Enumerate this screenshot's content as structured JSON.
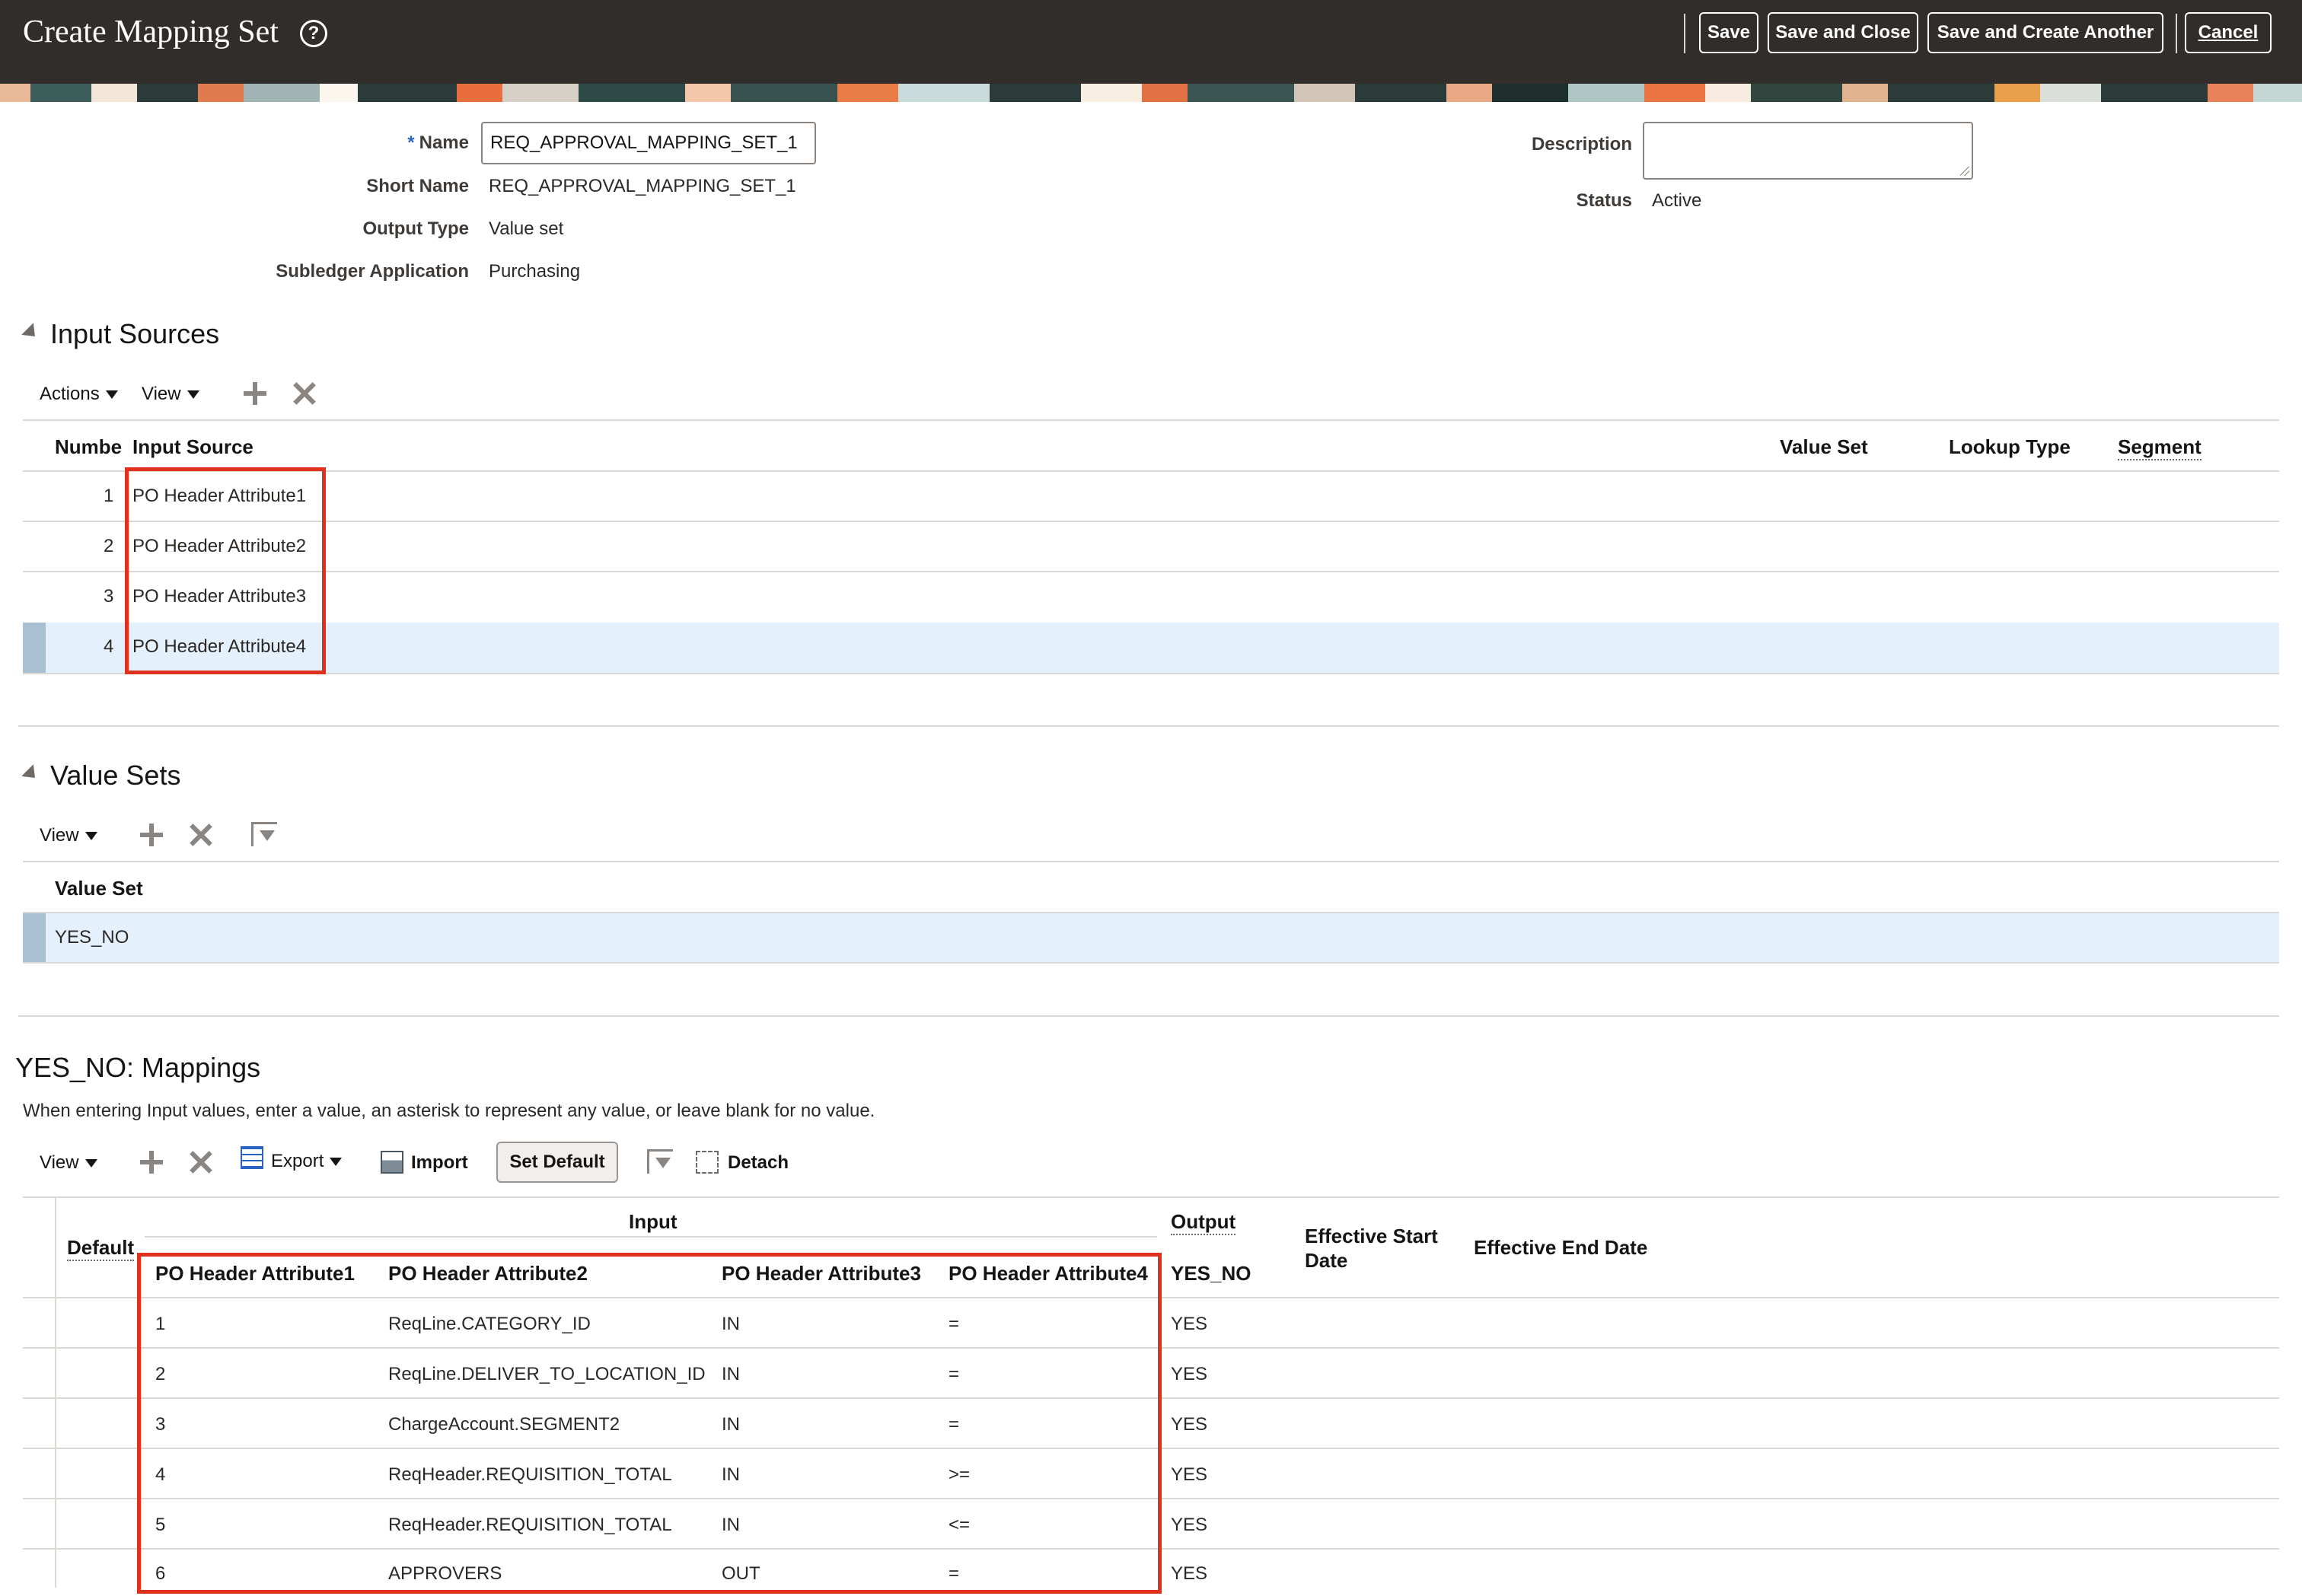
{
  "header": {
    "title": "Create Mapping Set",
    "help_icon": "?",
    "buttons": {
      "save": "Save",
      "save_close": "Save and Close",
      "save_create": "Save and Create Another",
      "cancel": "Cancel"
    }
  },
  "form": {
    "name_label": "Name",
    "name_value": "REQ_APPROVAL_MAPPING_SET_1",
    "short_name_label": "Short Name",
    "short_name_value": "REQ_APPROVAL_MAPPING_SET_1",
    "output_type_label": "Output Type",
    "output_type_value": "Value set",
    "subledger_label": "Subledger Application",
    "subledger_value": "Purchasing",
    "description_label": "Description",
    "description_value": "",
    "status_label": "Status",
    "status_value": "Active"
  },
  "input_sources": {
    "title": "Input Sources",
    "toolbar": {
      "actions": "Actions",
      "view": "View"
    },
    "columns": {
      "number": "Numbe",
      "input_source": "Input Source",
      "value_set": "Value Set",
      "lookup_type": "Lookup Type",
      "segment": "Segment"
    },
    "rows": [
      {
        "number": "1",
        "source": "PO Header Attribute1"
      },
      {
        "number": "2",
        "source": "PO Header Attribute2"
      },
      {
        "number": "3",
        "source": "PO Header Attribute3"
      },
      {
        "number": "4",
        "source": "PO Header Attribute4"
      }
    ]
  },
  "value_sets": {
    "title": "Value Sets",
    "toolbar": {
      "view": "View"
    },
    "column": "Value Set",
    "rows": [
      {
        "value_set": "YES_NO"
      }
    ]
  },
  "mappings": {
    "title": "YES_NO: Mappings",
    "hint": "When entering Input values, enter a value, an asterisk to represent any value, or leave blank for no value.",
    "toolbar": {
      "view": "View",
      "export": "Export",
      "import": "Import",
      "set_default": "Set Default",
      "detach": "Detach"
    },
    "group_headers": {
      "input": "Input",
      "output": "Output"
    },
    "columns": {
      "default": "Default",
      "attr1": "PO Header Attribute1",
      "attr2": "PO Header Attribute2",
      "attr3": "PO Header Attribute3",
      "attr4": "PO Header Attribute4",
      "output": "YES_NO",
      "eff_start": "Effective Start Date",
      "eff_end": "Effective End Date"
    },
    "rows": [
      {
        "a1": "1",
        "a2": "ReqLine.CATEGORY_ID",
        "a3": "IN",
        "a4": "=",
        "out": "YES"
      },
      {
        "a1": "2",
        "a2": "ReqLine.DELIVER_TO_LOCATION_ID",
        "a3": "IN",
        "a4": "=",
        "out": "YES"
      },
      {
        "a1": "3",
        "a2": "ChargeAccount.SEGMENT2",
        "a3": "IN",
        "a4": "=",
        "out": "YES"
      },
      {
        "a1": "4",
        "a2": "ReqHeader.REQUISITION_TOTAL",
        "a3": "IN",
        "a4": ">=",
        "out": "YES"
      },
      {
        "a1": "5",
        "a2": "ReqHeader.REQUISITION_TOTAL",
        "a3": "IN",
        "a4": "<=",
        "out": "YES"
      },
      {
        "a1": "6",
        "a2": "APPROVERS",
        "a3": "OUT",
        "a4": "=",
        "out": "YES"
      }
    ]
  },
  "colors": {
    "header_bg": "#312d2a",
    "selected_row": "#e4f0fc",
    "highlight_box": "#e0301e",
    "accent": "#2b63c2"
  }
}
